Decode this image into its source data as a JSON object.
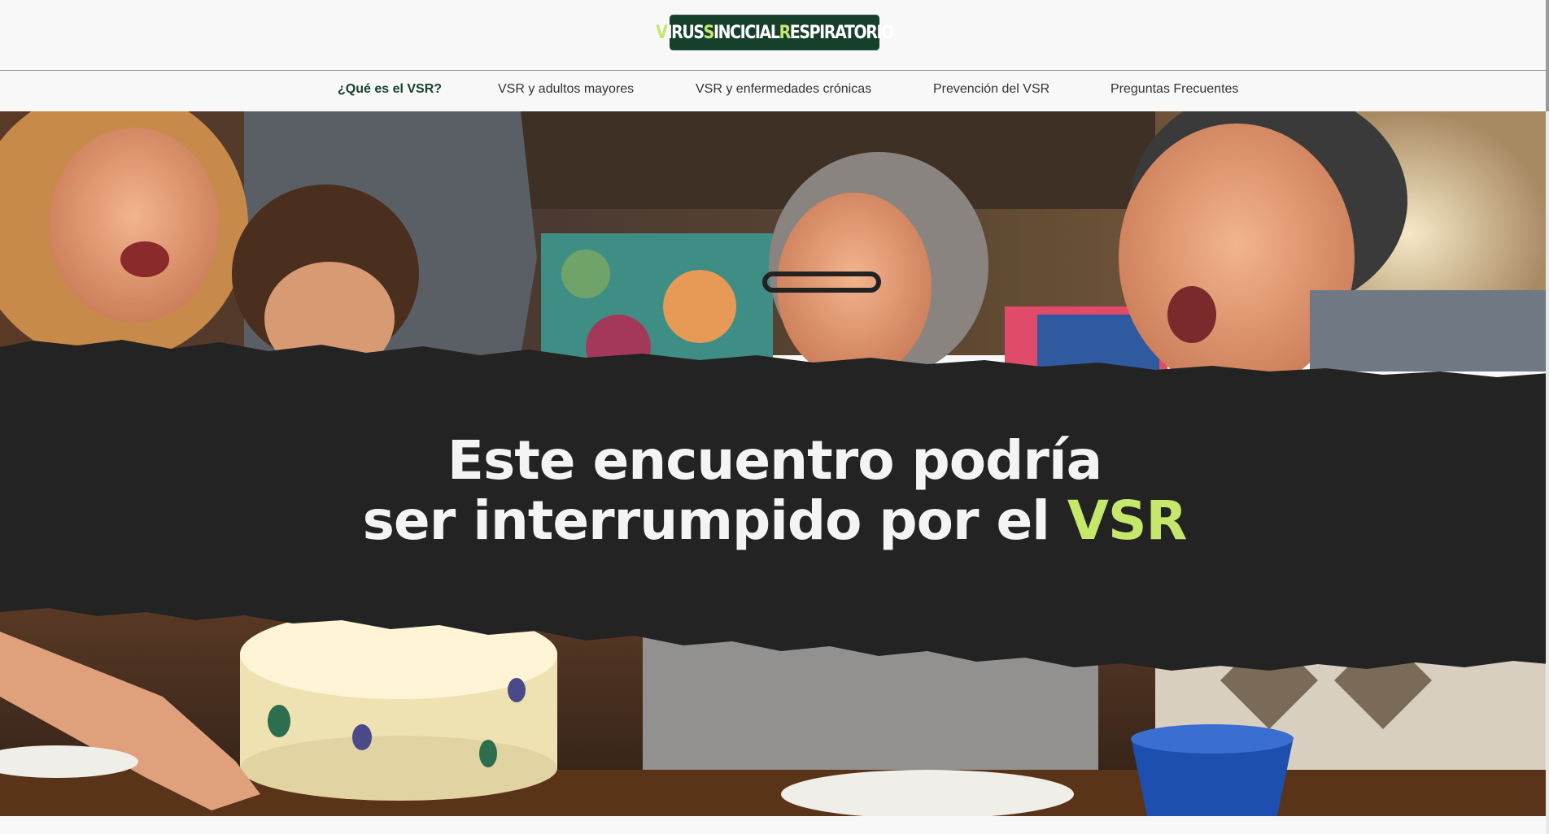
{
  "header": {
    "logo": {
      "words": [
        {
          "initial": "V",
          "rest": "IRUS"
        },
        {
          "initial": "S",
          "rest": "INCICIAL"
        },
        {
          "initial": "R",
          "rest": "ESPIRATORIO"
        }
      ]
    }
  },
  "nav": {
    "items": [
      {
        "label": "¿Qué es el VSR?",
        "active": true
      },
      {
        "label": "VSR y adultos mayores",
        "active": false
      },
      {
        "label": "VSR y enfermedades crónicas",
        "active": false
      },
      {
        "label": "Prevención del VSR",
        "active": false
      },
      {
        "label": "Preguntas Frecuentes",
        "active": false
      }
    ]
  },
  "hero": {
    "line1": "Este encuentro podría",
    "line2_prefix": "ser interrumpido por el",
    "line2_accent": "VSR"
  },
  "colors": {
    "brand_green": "#17402c",
    "accent_lime": "#c5e86c",
    "banner_dark": "#232323"
  }
}
